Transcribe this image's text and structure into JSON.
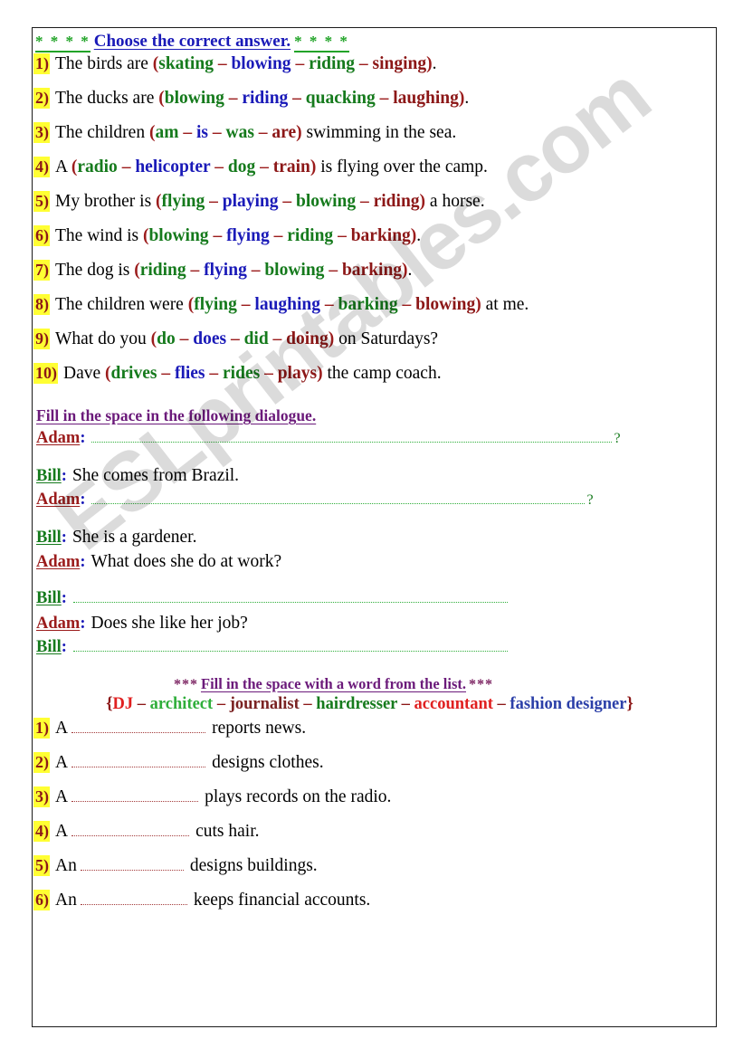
{
  "worksheet": {
    "section1": {
      "heading": {
        "stars_left": "* * * *",
        "text": "Choose the correct answer.",
        "stars_right": "* * * *"
      },
      "questions": [
        {
          "number": "1)",
          "before": "The birds are",
          "options": [
            "skating",
            "blowing",
            "riding",
            "singing"
          ],
          "after": "."
        },
        {
          "number": "2)",
          "before": "The ducks are",
          "options": [
            "blowing",
            "riding",
            "quacking",
            "laughing"
          ],
          "after": "."
        },
        {
          "number": "3)",
          "before": "The children",
          "options": [
            "am",
            "is",
            "was",
            "are"
          ],
          "after": " swimming in the sea."
        },
        {
          "number": "4)",
          "before": "A",
          "options": [
            "radio",
            "helicopter",
            "dog",
            "train"
          ],
          "after": " is flying over the camp."
        },
        {
          "number": "5)",
          "before": "My brother is",
          "options": [
            "flying",
            "playing",
            "blowing",
            "riding"
          ],
          "after": " a horse."
        },
        {
          "number": "6)",
          "before": "The wind is",
          "options": [
            "blowing",
            "flying",
            "riding",
            "barking"
          ],
          "after": "."
        },
        {
          "number": "7)",
          "before": "The dog is",
          "options": [
            "riding",
            "flying",
            "blowing",
            "barking"
          ],
          "after": "."
        },
        {
          "number": "8)",
          "before": "The children were",
          "options": [
            "flying",
            "laughing",
            "barking",
            "blowing"
          ],
          "after": " at me."
        },
        {
          "number": "9)",
          "before": "What do you",
          "options": [
            "do",
            "does",
            "did",
            "doing"
          ],
          "after": " on Saturdays?"
        },
        {
          "number": "10)",
          "before": "Dave",
          "options": [
            "drives",
            "flies",
            "rides",
            "plays"
          ],
          "after": " the camp coach."
        }
      ]
    },
    "section2": {
      "heading": "Fill in the space in the following dialogue.",
      "lines": [
        {
          "speaker": "Adam",
          "blank": true,
          "answer": "",
          "end": "?"
        },
        {
          "speaker": "Bill",
          "blank": false,
          "answer": "She comes from Brazil.",
          "end": ""
        },
        {
          "speaker": "Adam",
          "blank": true,
          "answer": "",
          "end": "?"
        },
        {
          "speaker": "Bill",
          "blank": false,
          "answer": "She is a gardener.",
          "end": ""
        },
        {
          "speaker": "Adam",
          "blank": false,
          "answer": "What does she do at work?",
          "end": ""
        },
        {
          "speaker": "Bill",
          "blank": true,
          "answer": "",
          "end": ""
        },
        {
          "speaker": "Adam",
          "blank": false,
          "answer": "Does she like her job?",
          "end": ""
        },
        {
          "speaker": "Bill",
          "blank": true,
          "answer": "",
          "end": ""
        }
      ],
      "colon": ":"
    },
    "section3": {
      "heading": {
        "stars_left": "***",
        "text": "Fill in the space with a word from the list.",
        "stars_right": "***"
      },
      "word_list": {
        "open": "{",
        "close": "}",
        "separator": "–",
        "words": [
          "DJ",
          "architect",
          "journalist",
          "hairdresser",
          "accountant",
          "fashion designer"
        ]
      },
      "items": [
        {
          "number": "1)",
          "article": "A",
          "tail": "reports news.",
          "dots_width": 148
        },
        {
          "number": "2)",
          "article": "A",
          "tail": "designs clothes.",
          "dots_width": 148
        },
        {
          "number": "3)",
          "article": "A",
          "tail": "plays records on the radio.",
          "dots_width": 140
        },
        {
          "number": "4)",
          "article": "A",
          "tail": "cuts hair.",
          "dots_width": 130
        },
        {
          "number": "5)",
          "article": "An",
          "tail": "designs buildings.",
          "dots_width": 114
        },
        {
          "number": "6)",
          "article": "An",
          "tail": "keeps financial accounts.",
          "dots_width": 118
        }
      ]
    },
    "watermark": "ESLprintables.com"
  },
  "colors": {
    "green": "#157a1c",
    "blue": "#1a1ab8",
    "dark_red": "#8c1717",
    "purple": "#6b1a7a",
    "highlight": "#ffff33",
    "dots_green": "#2fae3a",
    "dots_red": "#a33a3a"
  }
}
